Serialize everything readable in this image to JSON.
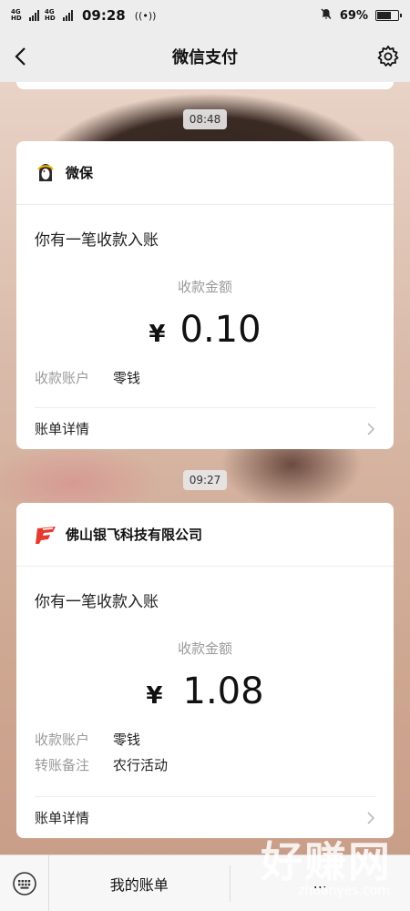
{
  "status_bar": {
    "network_1": "4G HD",
    "network_2": "4G HD",
    "time": "09:28",
    "battery": "69%",
    "battery_level": 0.69
  },
  "nav": {
    "title": "微信支付",
    "back_icon": "chevron-left-icon",
    "settings_icon": "gear-icon"
  },
  "messages": [
    {
      "time": "08:48",
      "merchant": "微保",
      "merchant_icon": "weibao-logo-icon",
      "headline": "你有一笔收款入账",
      "amount_label": "收款金额",
      "currency": "¥",
      "amount": "0.10",
      "rows": [
        {
          "key": "收款账户",
          "value": "零钱"
        }
      ],
      "detail_label": "账单详情"
    },
    {
      "time": "09:27",
      "merchant": "佛山银飞科技有限公司",
      "merchant_icon": "yinfei-logo-icon",
      "headline": "你有一笔收款入账",
      "amount_label": "收款金额",
      "currency": "¥",
      "amount": "1.08",
      "rows": [
        {
          "key": "收款账户",
          "value": "零钱"
        },
        {
          "key": "转账备注",
          "value": "农行活动"
        }
      ],
      "detail_label": "账单详情"
    }
  ],
  "bottom_bar": {
    "keyboard_icon": "keyboard-icon",
    "menu_1": "我的账单",
    "menu_2": "..."
  },
  "watermark": {
    "text": "好赚网",
    "url": "zhuanyes.com"
  },
  "colors": {
    "nav_bg": "#ededed",
    "card_bg": "#ffffff",
    "muted_text": "#9a9a9a",
    "yinfei_red": "#e53a2d",
    "weibao_yellow": "#f2b400"
  }
}
